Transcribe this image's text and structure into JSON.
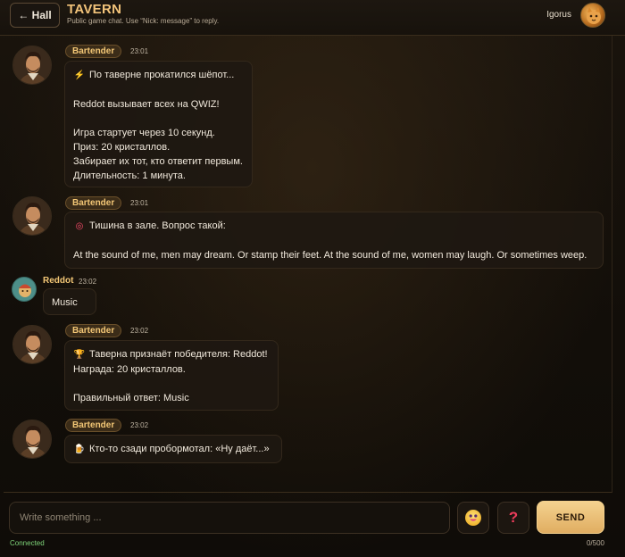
{
  "header": {
    "back_label": "← Hall",
    "title": "TAVERN",
    "subtitle": "Public game chat. Use “Nick: message” to reply.",
    "user_name": "Igorus"
  },
  "messages": [
    {
      "author": "Bartender",
      "time": "23:01",
      "icon": "lightning-icon",
      "lines": [
        "По таверне прокатился шёпот...",
        "",
        "Reddot вызывает всех на QWIZ!",
        "",
        "Игра стартует через 10 секунд.",
        "Приз: 20 кристаллов.",
        "Забирает их тот, кто ответит первым.",
        "Длительность: 1 минута."
      ]
    },
    {
      "author": "Bartender",
      "time": "23:01",
      "icon": "target-icon",
      "lines": [
        "Тишина в зале. Вопрос такой:",
        "",
        "At the sound of me, men may dream. Or stamp their feet. At the sound of me, women may laugh. Or sometimes weep."
      ]
    },
    {
      "author": "Reddot",
      "time": "23:02",
      "lines": [
        "Music"
      ]
    },
    {
      "author": "Bartender",
      "time": "23:02",
      "icon": "trophy-icon",
      "lines": [
        "Таверна признаёт победителя: Reddot!",
        "Награда: 20 кристаллов.",
        "",
        "Правильный ответ: Music"
      ]
    },
    {
      "author": "Bartender",
      "time": "23:02",
      "icon": "beer-mug-icon",
      "lines": [
        "Кто-то сзади пробормотал: «Ну даёт...»"
      ]
    }
  ],
  "composer": {
    "placeholder": "Write something ...",
    "send_label": "SEND",
    "help_label": "?",
    "status": "Connected",
    "counter": "0/500"
  },
  "colors": {
    "accent": "#f3c776",
    "send": "#e9bd72",
    "status": "#7fd67a",
    "help": "#ec3c5b"
  }
}
